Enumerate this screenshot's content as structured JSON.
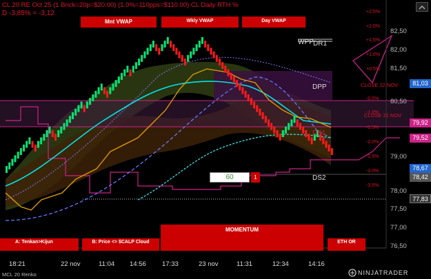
{
  "header": {
    "line1": "CL 20 RE Oct 25 (1 Brick=20p=$20.00)  (1.0%=110pps=$110.00)  CL Daily RTH %",
    "line2": " D -3,85% = -3,12"
  },
  "buttons": {
    "mnt_vwap": "Mnt VWAP",
    "wkly_vwap": "Wkly VWAP",
    "day_vwap": "Day VWAP",
    "momentum": "MOMENTUM",
    "tenkan_kijun": "A: Tenkan>Kijun",
    "price_scalp": "B: Price <> $CALP Cloud",
    "eth_or": "ETH OR"
  },
  "level_labels": {
    "wpp": "WPP",
    "dr1": "DR1",
    "dpp": "DPP",
    "ds1": "DS1",
    "ds2": "DS2",
    "close_22": "CLOSE 22 NOV",
    "close_21": "CLOSE 21 NOV"
  },
  "counter_box": {
    "value": "60",
    "tag": "1"
  },
  "footer": {
    "instrument": "MCL 20 Renko",
    "brand": "NINJATRADER"
  },
  "colors": {
    "up": "#00e676",
    "down": "#ff1a1a",
    "tenkan": "#e6a000",
    "kijun": "#00e5e5",
    "pivot_magenta": "#cc2288",
    "dashed_vwap": "#6677ff",
    "cloud_green": "#2e3b12",
    "cloud_brown": "#3d2208"
  },
  "chart_data": {
    "type": "candlestick",
    "title": "",
    "y_axis": {
      "ticks": [
        "82,50",
        "82,00",
        "81,50",
        "81,00",
        "80,50",
        "80,00",
        "79,50",
        "79,00",
        "78,50",
        "78,00",
        "77,50",
        "77,00",
        "76,50"
      ],
      "ylim": [
        76.3,
        82.9
      ]
    },
    "pct_axis": [
      "+2.5%",
      "+2.0%",
      "+1.5%",
      "+1.0%",
      "+0.5%",
      "-0.5%",
      "-1.0%",
      "-1.5%",
      "-2.0%",
      "-2.5%",
      "-3.0%",
      "-3.5%"
    ],
    "x_axis": [
      "18:21",
      "22 nov",
      "11:04",
      "14:56",
      "17:33",
      "23 nov",
      "11:31",
      "12:34",
      "14:16"
    ],
    "price_labels": [
      {
        "value": "81,03",
        "color": "#2266cc"
      },
      {
        "value": "79,92",
        "color": "#cc2288"
      },
      {
        "value": "79,52",
        "color": "#cc2288"
      },
      {
        "value": "78,67",
        "color": "#2266cc"
      },
      {
        "value": "78,42",
        "color": "#555555"
      },
      {
        "value": "77,83",
        "color": "#333333"
      }
    ],
    "bricks": [
      [
        0,
        "up"
      ],
      [
        0.2,
        "up"
      ],
      [
        0.4,
        "up"
      ],
      [
        0.6,
        "up"
      ],
      [
        0.8,
        "up"
      ],
      [
        1.0,
        "up"
      ],
      [
        1.2,
        "up"
      ],
      [
        1.4,
        "up"
      ],
      [
        1.6,
        "up"
      ],
      [
        1.4,
        "down"
      ],
      [
        1.2,
        "down"
      ],
      [
        1.4,
        "up"
      ],
      [
        1.6,
        "up"
      ],
      [
        1.8,
        "up"
      ],
      [
        2.0,
        "up"
      ],
      [
        2.2,
        "up"
      ],
      [
        2.0,
        "down"
      ],
      [
        1.8,
        "down"
      ],
      [
        2.0,
        "up"
      ],
      [
        2.2,
        "up"
      ],
      [
        2.4,
        "up"
      ],
      [
        2.6,
        "up"
      ],
      [
        2.8,
        "up"
      ],
      [
        3.0,
        "up"
      ],
      [
        3.2,
        "up"
      ],
      [
        3.4,
        "up"
      ],
      [
        3.6,
        "up"
      ],
      [
        3.4,
        "down"
      ],
      [
        3.6,
        "up"
      ],
      [
        3.8,
        "up"
      ],
      [
        4.0,
        "up"
      ],
      [
        4.2,
        "up"
      ],
      [
        4.4,
        "up"
      ],
      [
        4.6,
        "up"
      ],
      [
        4.4,
        "down"
      ],
      [
        4.2,
        "down"
      ],
      [
        4.4,
        "up"
      ],
      [
        4.6,
        "up"
      ],
      [
        4.8,
        "up"
      ],
      [
        5.0,
        "up"
      ],
      [
        5.2,
        "up"
      ],
      [
        5.4,
        "up"
      ],
      [
        5.6,
        "up"
      ],
      [
        5.4,
        "down"
      ],
      [
        5.6,
        "up"
      ],
      [
        5.8,
        "up"
      ],
      [
        6.0,
        "up"
      ],
      [
        6.2,
        "up"
      ],
      [
        6.4,
        "up"
      ],
      [
        6.6,
        "up"
      ],
      [
        6.8,
        "up"
      ],
      [
        7.0,
        "up"
      ],
      [
        6.8,
        "down"
      ],
      [
        6.6,
        "down"
      ],
      [
        6.8,
        "up"
      ],
      [
        7.0,
        "up"
      ],
      [
        7.2,
        "up"
      ],
      [
        7.0,
        "down"
      ],
      [
        6.8,
        "down"
      ],
      [
        6.6,
        "down"
      ],
      [
        6.4,
        "down"
      ],
      [
        6.2,
        "down"
      ],
      [
        6.0,
        "down"
      ],
      [
        6.2,
        "up"
      ],
      [
        6.4,
        "up"
      ],
      [
        6.6,
        "up"
      ],
      [
        6.8,
        "up"
      ],
      [
        7.0,
        "up"
      ],
      [
        7.2,
        "up"
      ],
      [
        7.0,
        "down"
      ],
      [
        6.8,
        "down"
      ],
      [
        6.6,
        "down"
      ],
      [
        6.4,
        "down"
      ],
      [
        6.2,
        "down"
      ],
      [
        6.0,
        "down"
      ],
      [
        5.8,
        "down"
      ],
      [
        5.6,
        "down"
      ],
      [
        5.4,
        "down"
      ],
      [
        5.2,
        "down"
      ],
      [
        5.0,
        "down"
      ],
      [
        4.8,
        "down"
      ],
      [
        4.6,
        "down"
      ],
      [
        4.4,
        "down"
      ],
      [
        4.2,
        "down"
      ],
      [
        4.0,
        "down"
      ],
      [
        3.8,
        "down"
      ],
      [
        3.6,
        "down"
      ],
      [
        3.4,
        "down"
      ],
      [
        3.2,
        "down"
      ],
      [
        3.0,
        "down"
      ],
      [
        2.8,
        "down"
      ],
      [
        2.6,
        "down"
      ],
      [
        2.4,
        "down"
      ],
      [
        2.2,
        "down"
      ],
      [
        2.0,
        "down"
      ],
      [
        1.8,
        "down"
      ],
      [
        2.0,
        "up"
      ],
      [
        2.2,
        "up"
      ],
      [
        2.4,
        "up"
      ],
      [
        2.6,
        "up"
      ],
      [
        2.8,
        "up"
      ],
      [
        2.6,
        "down"
      ],
      [
        2.4,
        "down"
      ],
      [
        2.2,
        "down"
      ],
      [
        2.0,
        "down"
      ],
      [
        1.8,
        "down"
      ],
      [
        1.6,
        "down"
      ],
      [
        1.8,
        "up"
      ],
      [
        2.0,
        "up"
      ],
      [
        1.8,
        "down"
      ],
      [
        1.6,
        "down"
      ],
      [
        1.4,
        "down"
      ],
      [
        1.2,
        "down"
      ],
      [
        1.0,
        "down"
      ]
    ]
  }
}
